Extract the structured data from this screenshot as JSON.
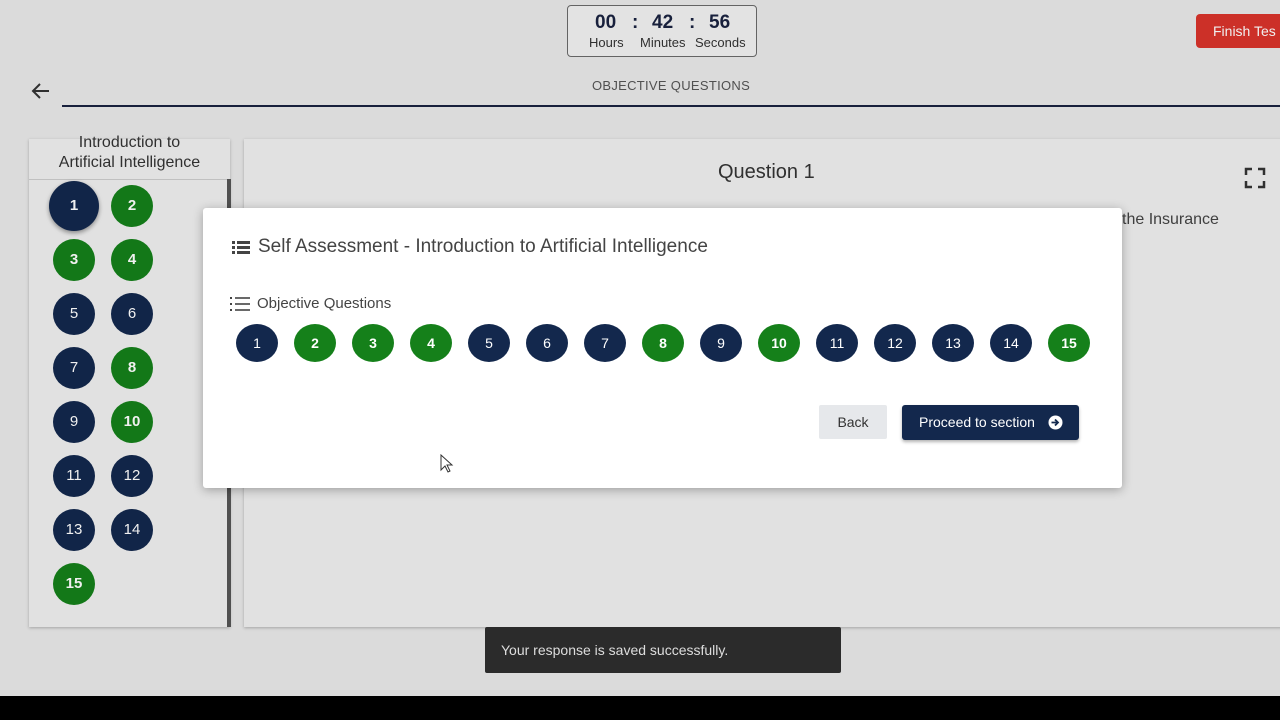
{
  "timer": {
    "hours": "00",
    "minutes": "42",
    "seconds": "56",
    "hours_label": "Hours",
    "minutes_label": "Minutes",
    "seconds_label": "Seconds",
    "separator": ":"
  },
  "finish_button": "Finish Tes",
  "header": {
    "title": "OBJECTIVE QUESTIONS"
  },
  "sidebar": {
    "title_line1": "Introduction to",
    "title_line2": "Artificial Intelligence",
    "questions": [
      {
        "n": "1",
        "status": "current"
      },
      {
        "n": "2",
        "status": "answered"
      },
      {
        "n": "3",
        "status": "answered"
      },
      {
        "n": "4",
        "status": "answered"
      },
      {
        "n": "5",
        "status": "unanswered"
      },
      {
        "n": "6",
        "status": "unanswered"
      },
      {
        "n": "7",
        "status": "unanswered"
      },
      {
        "n": "8",
        "status": "answered"
      },
      {
        "n": "9",
        "status": "unanswered"
      },
      {
        "n": "10",
        "status": "answered"
      },
      {
        "n": "11",
        "status": "unanswered"
      },
      {
        "n": "12",
        "status": "unanswered"
      },
      {
        "n": "13",
        "status": "unanswered"
      },
      {
        "n": "14",
        "status": "unanswered"
      },
      {
        "n": "15",
        "status": "answered"
      }
    ]
  },
  "question": {
    "title": "Question 1",
    "text_fragment": "the Insurance"
  },
  "modal": {
    "title": "Self Assessment - Introduction to Artificial Intelligence",
    "section_label": "Objective Questions",
    "questions": [
      {
        "n": "1",
        "status": "unanswered"
      },
      {
        "n": "2",
        "status": "answered"
      },
      {
        "n": "3",
        "status": "answered"
      },
      {
        "n": "4",
        "status": "answered"
      },
      {
        "n": "5",
        "status": "unanswered"
      },
      {
        "n": "6",
        "status": "unanswered"
      },
      {
        "n": "7",
        "status": "unanswered"
      },
      {
        "n": "8",
        "status": "answered"
      },
      {
        "n": "9",
        "status": "unanswered"
      },
      {
        "n": "10",
        "status": "answered"
      },
      {
        "n": "11",
        "status": "unanswered"
      },
      {
        "n": "12",
        "status": "unanswered"
      },
      {
        "n": "13",
        "status": "unanswered"
      },
      {
        "n": "14",
        "status": "unanswered"
      },
      {
        "n": "15",
        "status": "answered"
      }
    ],
    "back_label": "Back",
    "proceed_label": "Proceed to section"
  },
  "toast": "Your response is saved successfully.",
  "colors": {
    "navy": "#13284d",
    "green": "#15801a",
    "danger": "#d9342b"
  }
}
